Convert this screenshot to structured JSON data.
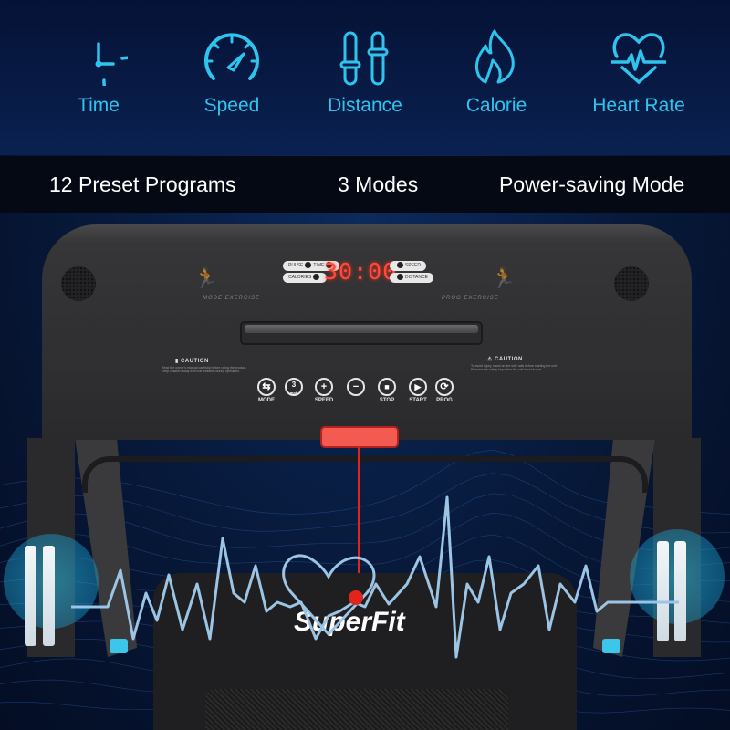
{
  "features": [
    {
      "label": "Time",
      "icon": "clock-icon"
    },
    {
      "label": "Speed",
      "icon": "speedometer-icon"
    },
    {
      "label": "Distance",
      "icon": "sliders-icon"
    },
    {
      "label": "Calorie",
      "icon": "flame-icon"
    },
    {
      "label": "Heart Rate",
      "icon": "heart-pulse-icon"
    }
  ],
  "highlights": [
    "12 Preset Programs",
    "3 Modes",
    "Power-saving Mode"
  ],
  "console": {
    "display": "30:00",
    "left_indicators": [
      "PULSE",
      "TIME",
      "CALORIES"
    ],
    "right_indicators": [
      "SPEED",
      "DISTANCE"
    ],
    "left_mode": "MODE EXERCISE",
    "right_mode": "PROG EXERCISE",
    "runner_label": "RUNNING",
    "caution_left": "CAUTION",
    "caution_left_note": "Read the owner's manual carefully before using the product. Keep children away from the treadmill during operation.",
    "caution_right": "CAUTION",
    "caution_right_note": "To avoid injury, stand on the side rails before starting the unit. Remove the safety key when the unit is not in use.",
    "buttons": [
      {
        "label": "MODE",
        "glyph": "⇆",
        "icon": "mode-icon"
      },
      {
        "label": "",
        "glyph": "3",
        "icon": "speed-preset-icon",
        "sub": "mph"
      },
      {
        "label": "",
        "glyph": "+",
        "icon": "plus-icon"
      },
      {
        "label": "",
        "glyph": "−",
        "icon": "minus-icon"
      },
      {
        "label": "STOP",
        "glyph": "■",
        "icon": "stop-icon"
      },
      {
        "label": "START",
        "glyph": "▶",
        "icon": "play-icon"
      },
      {
        "label": "PROG",
        "glyph": "⟳",
        "icon": "program-icon"
      }
    ],
    "speed_group_label": "SPEED"
  },
  "brand": "SuperFit",
  "colors": {
    "accent": "#2ec4ee",
    "display": "#ff4a3a",
    "safety_key": "#f25a52",
    "ecg": "#9cc4e4"
  }
}
